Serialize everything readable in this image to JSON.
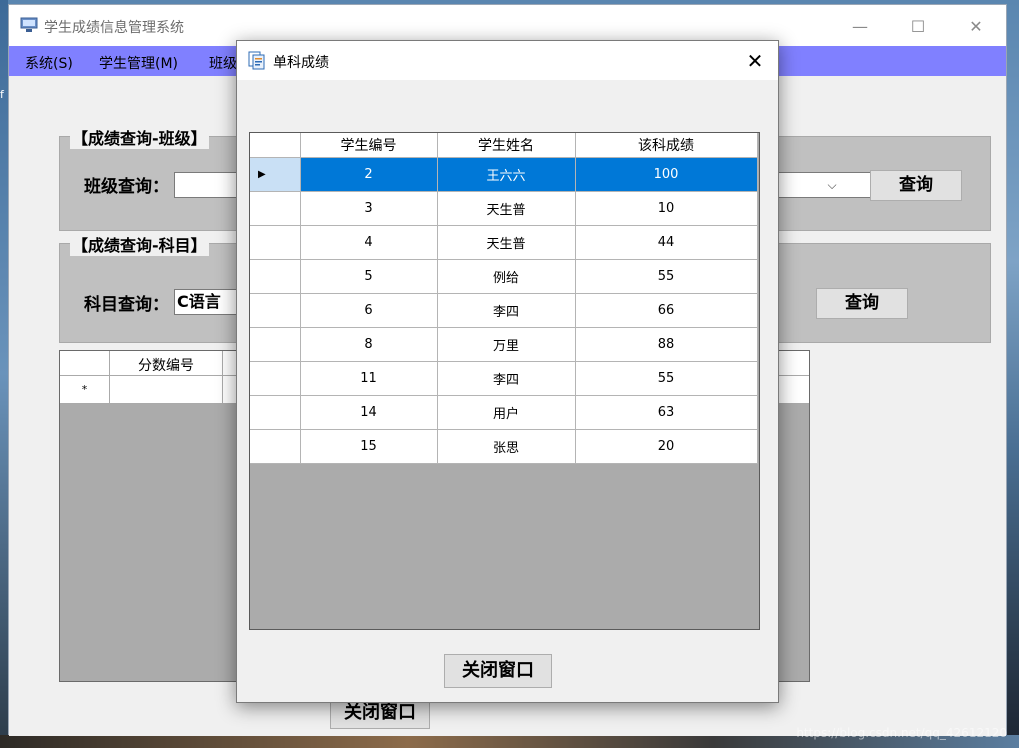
{
  "window": {
    "title": "学生成绩信息管理系统",
    "minimize_glyph": "—",
    "maximize_glyph": "☐",
    "close_glyph": "✕"
  },
  "menu": {
    "items": [
      "系统(S)",
      "学生管理(M)",
      "班级"
    ]
  },
  "class_query": {
    "group_title": "【成绩查询-班级】",
    "label": "班级查询：",
    "input_value": "",
    "button_label": "查询"
  },
  "subject_query": {
    "group_title": "【成绩查询-科目】",
    "label": "科目查询：",
    "input_value": "C语言",
    "button_label": "查询"
  },
  "background_grid": {
    "columns": [
      "分数编号"
    ],
    "new_row_marker": "*"
  },
  "background_close_button": "关闭窗口",
  "dialog": {
    "title": "单科成绩",
    "close_glyph": "✕",
    "columns": [
      "学生编号",
      "学生姓名",
      "该科成绩"
    ],
    "selected_marker": "▶",
    "rows": [
      {
        "id": "2",
        "name": "王六六",
        "score": "100"
      },
      {
        "id": "3",
        "name": "天生普",
        "score": "10"
      },
      {
        "id": "4",
        "name": "天生普",
        "score": "44"
      },
      {
        "id": "5",
        "name": "例给",
        "score": "55"
      },
      {
        "id": "6",
        "name": "李四",
        "score": "66"
      },
      {
        "id": "8",
        "name": "万里",
        "score": "88"
      },
      {
        "id": "11",
        "name": "李四",
        "score": "55"
      },
      {
        "id": "14",
        "name": "用户",
        "score": "63"
      },
      {
        "id": "15",
        "name": "张思",
        "score": "20"
      }
    ],
    "close_button": "关闭窗口"
  },
  "watermark": "https://blog.csdn.net/qq_42612120",
  "colors": {
    "menubar": "#8080ff",
    "selection": "#0078d7",
    "group_bg": "#c0c0c0",
    "grid_bg": "#ababab"
  }
}
